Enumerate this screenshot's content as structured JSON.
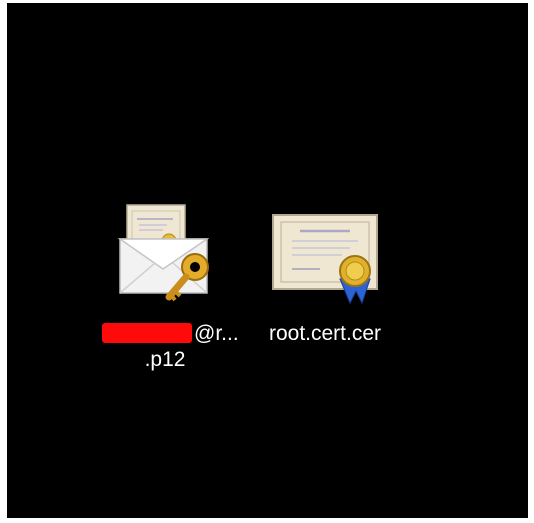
{
  "desktop": {
    "background_color": "#000000",
    "icons": [
      {
        "name": "p12-file",
        "icon": "certificate-envelope-key-icon",
        "label_line1": "@r...",
        "label_line2": ".p12",
        "redaction_color": "#ff0a0a",
        "redacted": true
      },
      {
        "name": "cer-file",
        "icon": "certificate-icon",
        "label_line1": "root.cert.cer",
        "seal_color": "#e0b22b",
        "ribbon_color": "#2b63d6"
      }
    ]
  }
}
